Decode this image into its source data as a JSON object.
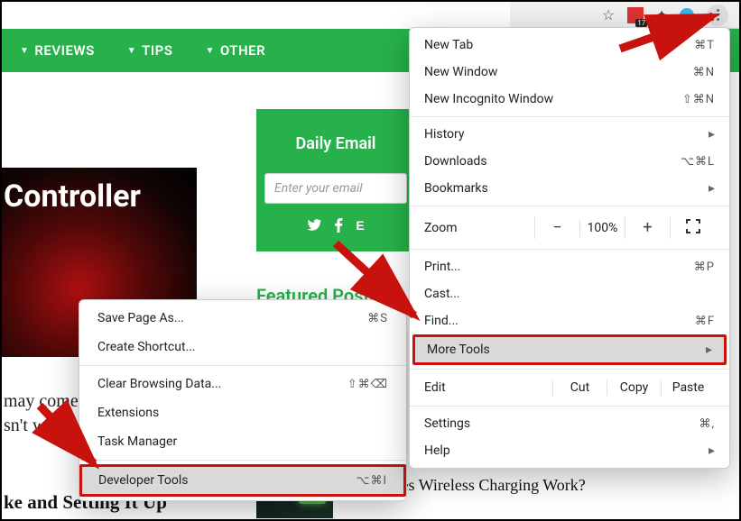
{
  "toolbar": {
    "ext_badge_count": "17"
  },
  "nav": {
    "items": [
      "REVIEWS",
      "TIPS",
      "OTHER"
    ]
  },
  "email_box": {
    "title": "Daily Email",
    "placeholder": "Enter your email"
  },
  "featured_label": "Featured Posts",
  "controller_label": "Controller",
  "article_snippet": "may come\nsn't work. A",
  "article_bottom": "ke and Setting It Up",
  "wireless_title": "How Does Wireless Charging Work?",
  "chrome_menu": {
    "new_tab": {
      "label": "New Tab",
      "shortcut": "⌘T"
    },
    "new_window": {
      "label": "New Window",
      "shortcut": "⌘N"
    },
    "new_incognito": {
      "label": "New Incognito Window",
      "shortcut": "⇧⌘N"
    },
    "history": {
      "label": "History"
    },
    "downloads": {
      "label": "Downloads",
      "shortcut": "⌥⌘L"
    },
    "bookmarks": {
      "label": "Bookmarks"
    },
    "zoom": {
      "label": "Zoom",
      "value": "100%"
    },
    "print": {
      "label": "Print...",
      "shortcut": "⌘P"
    },
    "cast": {
      "label": "Cast..."
    },
    "find": {
      "label": "Find...",
      "shortcut": "⌘F"
    },
    "more_tools": {
      "label": "More Tools"
    },
    "edit": {
      "label": "Edit",
      "cut": "Cut",
      "copy": "Copy",
      "paste": "Paste"
    },
    "settings": {
      "label": "Settings",
      "shortcut": "⌘,"
    },
    "help": {
      "label": "Help"
    }
  },
  "submenu": {
    "save_page": {
      "label": "Save Page As...",
      "shortcut": "⌘S"
    },
    "create_shortcut": {
      "label": "Create Shortcut..."
    },
    "clear_browsing": {
      "label": "Clear Browsing Data...",
      "shortcut": "⇧⌘⌫"
    },
    "extensions": {
      "label": "Extensions"
    },
    "task_manager": {
      "label": "Task Manager"
    },
    "developer_tools": {
      "label": "Developer Tools",
      "shortcut": "⌥⌘I"
    }
  }
}
